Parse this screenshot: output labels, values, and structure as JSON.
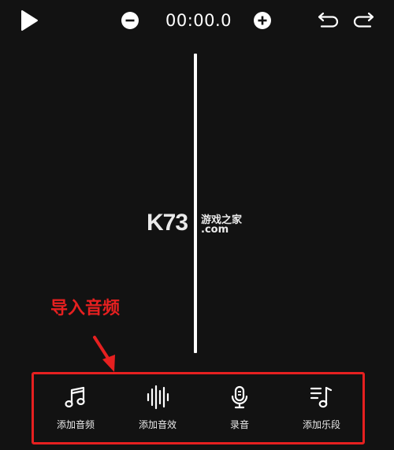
{
  "toolbar": {
    "time": "00:00.0",
    "play_icon": "play-icon",
    "zoom_out_icon": "minus-circle-icon",
    "zoom_in_icon": "plus-circle-icon",
    "undo_icon": "undo-icon",
    "redo_icon": "redo-icon"
  },
  "watermark": {
    "brand": "K73",
    "name": "游戏之家",
    "domain": ".com"
  },
  "annotation": {
    "label": "导入音频",
    "color": "#e62020"
  },
  "actions": [
    {
      "label": "添加音频",
      "icon": "music-note-icon"
    },
    {
      "label": "添加音效",
      "icon": "sound-wave-icon"
    },
    {
      "label": "录音",
      "icon": "microphone-icon"
    },
    {
      "label": "添加乐段",
      "icon": "music-list-icon"
    }
  ],
  "colors": {
    "background": "#121212",
    "foreground": "#ffffff",
    "highlight": "#e62020"
  }
}
